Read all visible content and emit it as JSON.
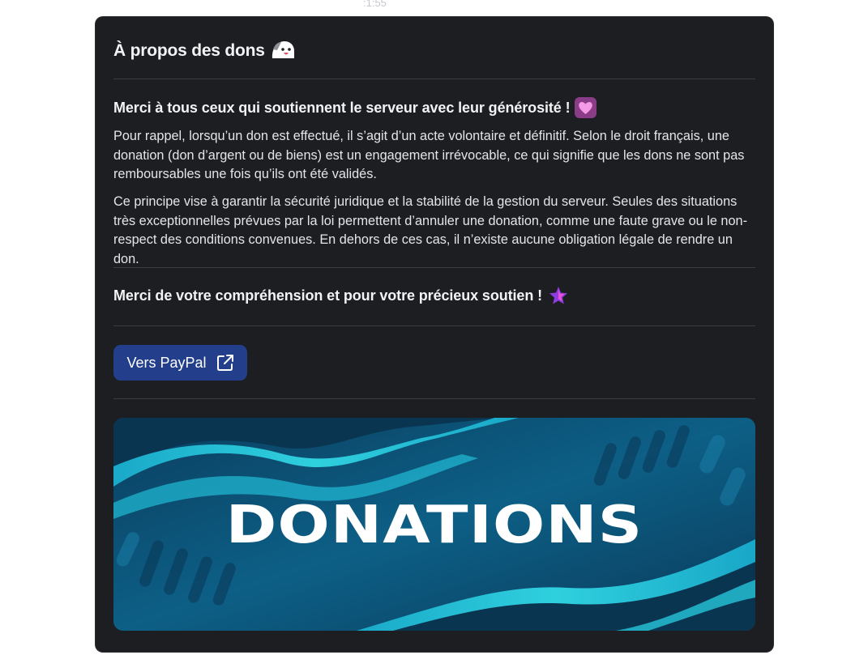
{
  "message": {
    "timestamp": ":1:55"
  },
  "embed": {
    "title": "À propos des dons",
    "title_emoji": "ghost-face-emoji",
    "heading": "Merci à tous ceux qui soutiennent le serveur avec leur générosité !",
    "heading_emoji": "pink-heart-emoji",
    "paragraph1": "Pour rappel, lorsqu’un don est effectué, il s’agit d’un acte volontaire et définitif. Selon le droit français, une donation (don d’argent ou de biens) est un engagement irrévocable, ce qui signifie que les dons ne sont pas remboursables une fois qu’ils ont été validés.",
    "paragraph2": "Ce principe vise à garantir la sécurité juridique et la stabilité de la gestion du serveur. Seules des situations très exceptionnelles prévues par la loi permettent d’annuler une donation, comme une faute grave ou le non-respect des conditions convenues. En dehors de ces cas, il n’existe aucune obligation légale de rendre un don.",
    "thanks": "Merci de votre compréhension et pour votre précieux soutien !",
    "thanks_emoji": "purple-star-emoji",
    "button_label": "Vers PayPal",
    "button_icon": "external-link-icon",
    "banner_text": "DONATIONS"
  },
  "colors": {
    "card_background": "#1d1e22",
    "button_background": "#233e8b",
    "banner_base": "#0b4a6e",
    "banner_wave": "#20c4d8"
  }
}
